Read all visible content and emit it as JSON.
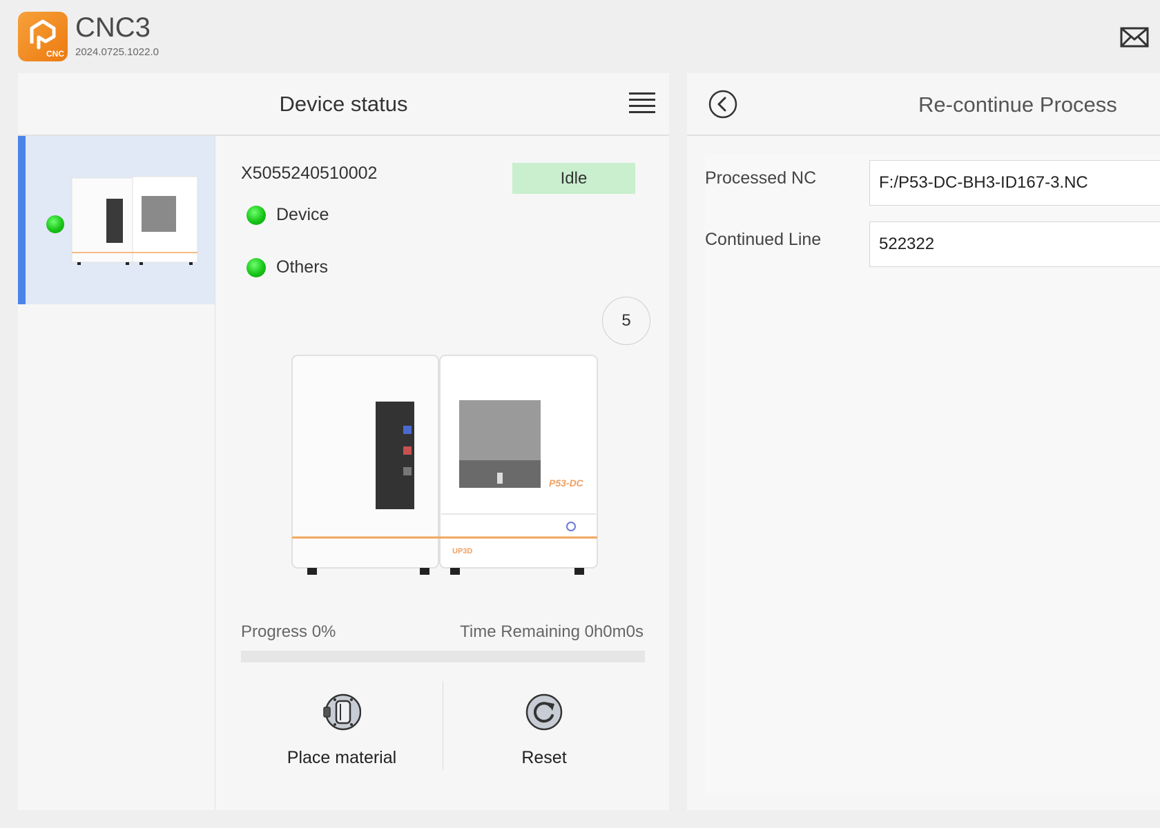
{
  "header": {
    "app_title": "CNC3",
    "version": "2024.0725.1022.0",
    "logo_badge_text": "CNC"
  },
  "device_status": {
    "title": "Device status",
    "device_list": [
      {
        "status": "online",
        "selected": true
      }
    ],
    "serial": "X5055240510002",
    "status_badge": "Idle",
    "indicators": [
      {
        "label": "Device",
        "status": "green"
      },
      {
        "label": "Others",
        "status": "green"
      }
    ],
    "count_badge": "5",
    "machine_model_label": "P53-DC",
    "machine_brand_label": "UP3D",
    "progress_label": "Progress 0%",
    "progress_value": 0,
    "time_remaining_label": "Time Remaining 0h0m0s",
    "actions": {
      "place_material": "Place material",
      "reset": "Reset"
    }
  },
  "recontinue": {
    "title": "Re-continue Process",
    "fields": {
      "processed_nc": {
        "label": "Processed NC",
        "value": "F:/P53-DC-BH3-ID167-3.NC"
      },
      "continued_line": {
        "label": "Continued Line",
        "value": "522322"
      }
    }
  },
  "icons": {
    "mail": "mail-icon",
    "menu": "hamburger-menu-icon",
    "back": "back-arrow-icon",
    "place_material": "place-material-icon",
    "reset": "reset-icon"
  },
  "colors": {
    "accent": "#4a84e8",
    "brand_orange": "#ec7a10",
    "idle_badge": "#c9efce",
    "status_green": "#18c418",
    "selected_row": "#e1e8f6"
  }
}
